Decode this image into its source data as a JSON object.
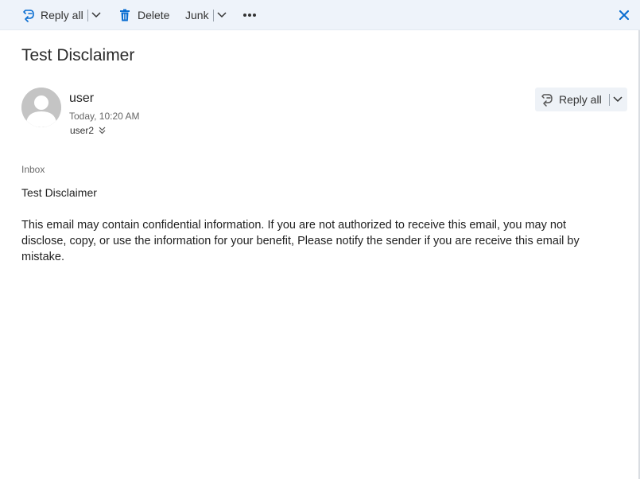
{
  "toolbar": {
    "reply_all_label": "Reply all",
    "delete_label": "Delete",
    "junk_label": "Junk"
  },
  "message": {
    "subject": "Test Disclaimer",
    "sender": "user",
    "timestamp": "Today, 10:20 AM",
    "recipient": "user2",
    "reply_all_label": "Reply all",
    "folder": "Inbox",
    "body_heading": "Test Disclaimer",
    "body_text": "This email may contain confidential information. If you are not authorized to receive this email, you may not disclose, copy, or use the information for your benefit, Please notify the sender if you are receive this email by mistake."
  },
  "icons": {
    "reply_all": "reply-all-icon",
    "chevron": "chevron-down-icon",
    "delete": "trash-icon",
    "more": "more-icon",
    "close": "close-icon",
    "avatar": "user-avatar",
    "expand": "double-chevron-down-icon"
  },
  "colors": {
    "accent": "#0078d4",
    "toolbar_bg": "#eef3fa"
  }
}
